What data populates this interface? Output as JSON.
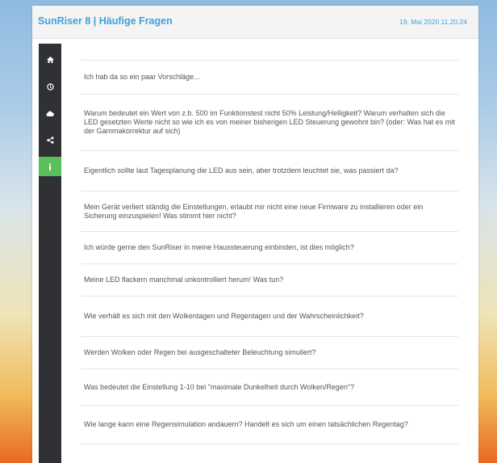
{
  "header": {
    "title": "SunRiser 8 | Häufige Fragen",
    "datetime": "19. Mai 2020 11.20.24"
  },
  "sidebar": {
    "items": [
      {
        "icon": "home-icon"
      },
      {
        "icon": "clock-icon"
      },
      {
        "icon": "cloud-icon"
      },
      {
        "icon": "share-icon"
      },
      {
        "icon": "info-icon",
        "active": true
      }
    ]
  },
  "faq": [
    "Ich hab da so ein paar Vorschläge...",
    "Warum bedeutet ein Wert von z.b. 500 im Funktionstest nicht 50% Leistung/Helligkeit? Warum verhalten sich die LED gesetzten Werte nicht so wie ich es von meiner bisherigen LED Steuerung gewohnt bin? (oder: Was hat es mit der Gammakorrektur auf sich)",
    "Eigentlich sollte laut Tagesplanung die LED aus sein, aber trotzdem leuchtet sie, was passiert da?",
    "Mein Gerät verliert ständig die Einstellungen, erlaubt mir nicht eine neue Firmware zu installieren oder ein Sicherung einzuspielen! Was stimmt hier nicht?",
    "Ich würde gerne den SunRiser in meine Haussteuerung einbinden, ist dies möglich?",
    "Meine LED flackern manchmal unkontrolliert herum! Was tun?",
    "Wie verhält es sich mit den Wolkentagen und Regentagen und der Wahrscheinlichkeit?",
    "Werden Wolken oder Regen bei ausgeschalteter Beleuchtung simuliert?",
    "Was bedeutet die Einstellung 1-10 bei \"maximale Dunkelheit durch Wolken/Regen\"?",
    "Wie lange kann eine Regensimulation andauern? Handelt es sich um einen tatsächlichen Regentag?"
  ],
  "colors": {
    "accent": "#3ea0d9",
    "sidebar_bg": "#2f3135",
    "active_nav": "#5cc05a"
  }
}
